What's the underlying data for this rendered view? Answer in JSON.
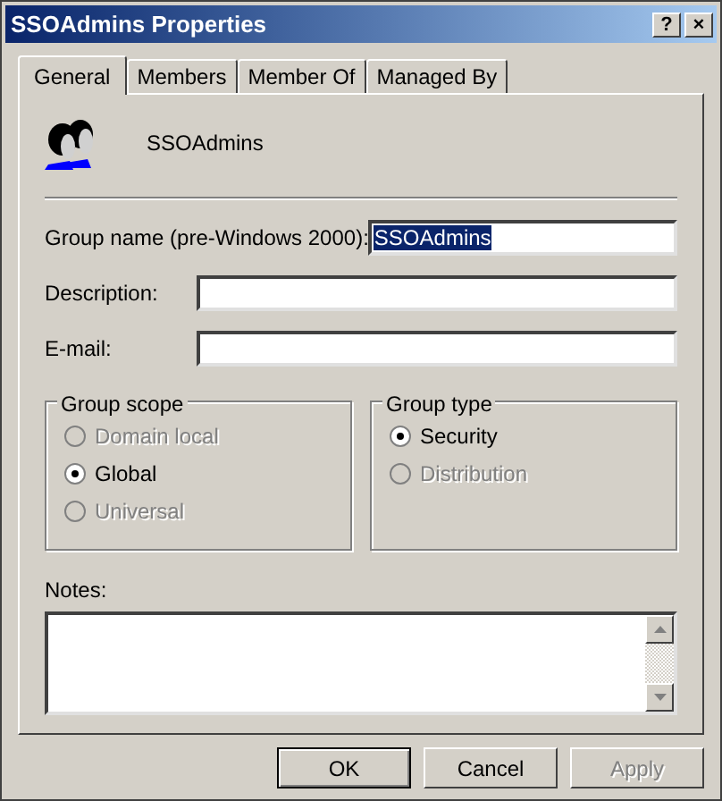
{
  "window": {
    "title": "SSOAdmins Properties",
    "buttons": [
      "?",
      "×"
    ]
  },
  "tabs": [
    {
      "label": "General",
      "selected": true
    },
    {
      "label": "Members",
      "selected": false
    },
    {
      "label": "Member Of",
      "selected": false
    },
    {
      "label": "Managed By",
      "selected": false
    }
  ],
  "header": {
    "name": "SSOAdmins"
  },
  "fields": [
    {
      "label": "Group name (pre-Windows 2000):",
      "value": "SSOAdmins",
      "highlighted": true
    },
    {
      "label": "Description:"
    },
    {
      "label": "E-mail:"
    }
  ],
  "groups": [
    {
      "title": "Group scope",
      "options": [
        {
          "label": "Domain local",
          "selected": false,
          "disabled": true
        },
        {
          "label": "Global",
          "selected": true,
          "disabled": false
        },
        {
          "label": "Universal",
          "selected": false,
          "disabled": true
        }
      ]
    },
    {
      "title": "Group type",
      "options": [
        {
          "label": "Security",
          "selected": true,
          "disabled": false
        },
        {
          "label": "Distribution",
          "selected": false,
          "disabled": true
        }
      ]
    }
  ],
  "notes": {
    "label": "Notes:"
  },
  "buttons": [
    {
      "label": "OK",
      "default": true,
      "disabled": false
    },
    {
      "label": "Cancel",
      "default": false,
      "disabled": false
    },
    {
      "label": "Apply",
      "default": false,
      "disabled": true
    }
  ]
}
